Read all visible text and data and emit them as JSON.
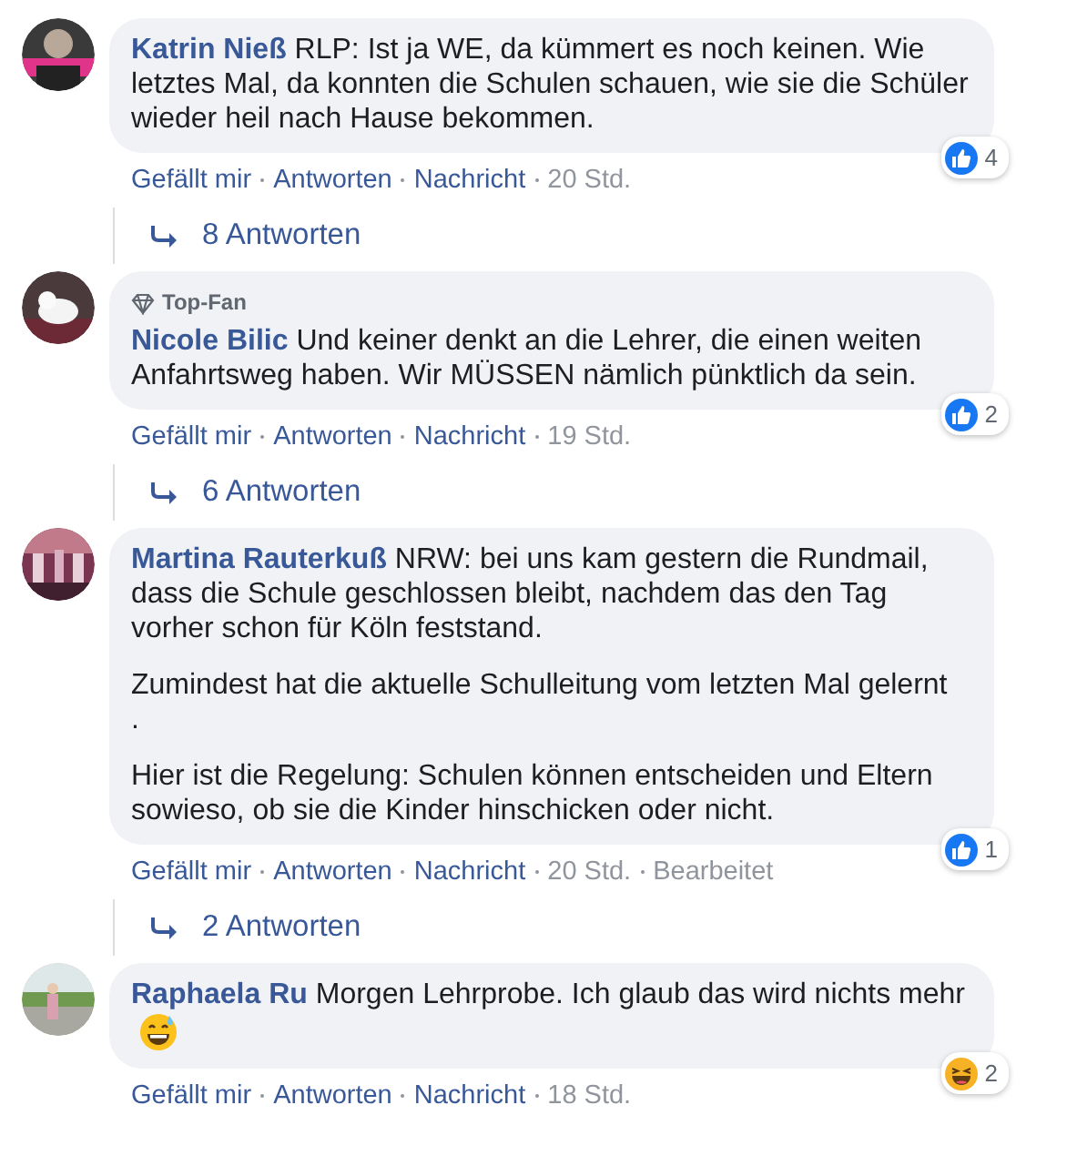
{
  "comments": [
    {
      "author": "Katrin Nieß",
      "paragraphs": [
        "RLP: Ist ja WE, da kümmert es noch keinen. Wie letztes Mal, da konnten die Schulen schauen, wie sie die Schüler wieder heil nach Hause bekommen."
      ],
      "reaction": {
        "kind": "like",
        "count": "4"
      },
      "actions": [
        "Gefällt mir",
        "Antworten",
        "Nachricht"
      ],
      "time": "20 Std.",
      "replies": "8 Antworten"
    },
    {
      "author": "Nicole Bilic",
      "badge": "Top-Fan",
      "paragraphs": [
        "Und keiner denkt an die Lehrer, die einen weiten Anfahrtsweg haben. Wir MÜSSEN nämlich pünktlich da sein."
      ],
      "reaction": {
        "kind": "like",
        "count": "2"
      },
      "actions": [
        "Gefällt mir",
        "Antworten",
        "Nachricht"
      ],
      "time": "19 Std.",
      "replies": "6 Antworten"
    },
    {
      "author": "Martina Rauterkuß",
      "paragraphs": [
        "NRW: bei uns kam gestern die Rundmail, dass die Schule geschlossen bleibt, nachdem das den Tag vorher schon für Köln feststand.",
        "Zumindest hat die aktuelle Schulleitung vom letzten Mal gelernt\n.",
        "Hier ist die Regelung: Schulen können entscheiden und Eltern sowieso, ob sie die Kinder hinschicken oder nicht."
      ],
      "reaction": {
        "kind": "like",
        "count": "1"
      },
      "actions": [
        "Gefällt mir",
        "Antworten",
        "Nachricht"
      ],
      "time": "20 Std.",
      "edited": "Bearbeitet",
      "replies": "2 Antworten"
    },
    {
      "author": "Raphaela Ru",
      "paragraphs": [
        "Morgen Lehrprobe. Ich glaub das wird nichts mehr"
      ],
      "emoji": {
        "kind": "grin-sweat"
      },
      "reaction": {
        "kind": "haha",
        "count": "2"
      },
      "actions": [
        "Gefällt mir",
        "Antworten",
        "Nachricht"
      ],
      "time": "18 Std."
    }
  ]
}
